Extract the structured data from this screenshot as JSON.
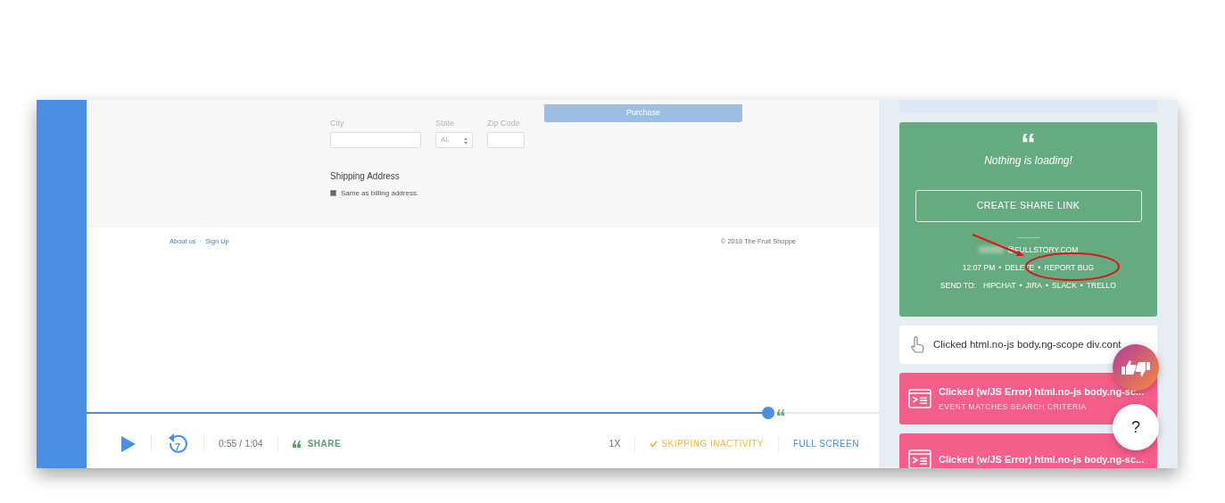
{
  "form": {
    "purchase_button": "Purchase",
    "fields": [
      {
        "label": "City",
        "kind": "text"
      },
      {
        "label": "State",
        "kind": "select",
        "value": "AL"
      },
      {
        "label": "Zip Code",
        "kind": "text"
      }
    ],
    "shipping_heading": "Shipping Address",
    "same_as_billing": {
      "label": "Same as billing address.",
      "checked": true
    }
  },
  "footer": {
    "links": [
      "About us",
      "Sign Up"
    ],
    "separator": "·",
    "copyright": "© 2018 The Fruit Shoppe"
  },
  "player": {
    "level": 0.86,
    "skip_seconds": "7",
    "time": "0:55 / 1:04",
    "share": "SHARE",
    "speed": "1X",
    "skipping": {
      "label": "SKIPPING INACTIVITY",
      "checked": true
    },
    "full_screen": "FULL SCREEN"
  },
  "note": {
    "quote": "“",
    "text": "Nothing is loading!",
    "button": "CREATE SHARE LINK",
    "email": "@FULLSTORY.COM",
    "time": "12:07 PM",
    "separator": "•",
    "actions": [
      "DELETE",
      "REPORT BUG"
    ],
    "send_to_label": "SEND TO:",
    "send_to": [
      "HIPCHAT",
      "JIRA",
      "SLACK",
      "TRELLO"
    ]
  },
  "events": [
    {
      "kind": "click",
      "title": "Clicked html.no-js body.ng-scope div.cont"
    },
    {
      "kind": "error",
      "title": "Clicked (w/JS Error) html.no-js body.ng-sc...",
      "subtitle": "EVENT MATCHES SEARCH CRITERIA"
    },
    {
      "kind": "error",
      "title": "Clicked (w/JS Error) html.no-js body.ng-sc..."
    }
  ],
  "help_button": "?"
}
